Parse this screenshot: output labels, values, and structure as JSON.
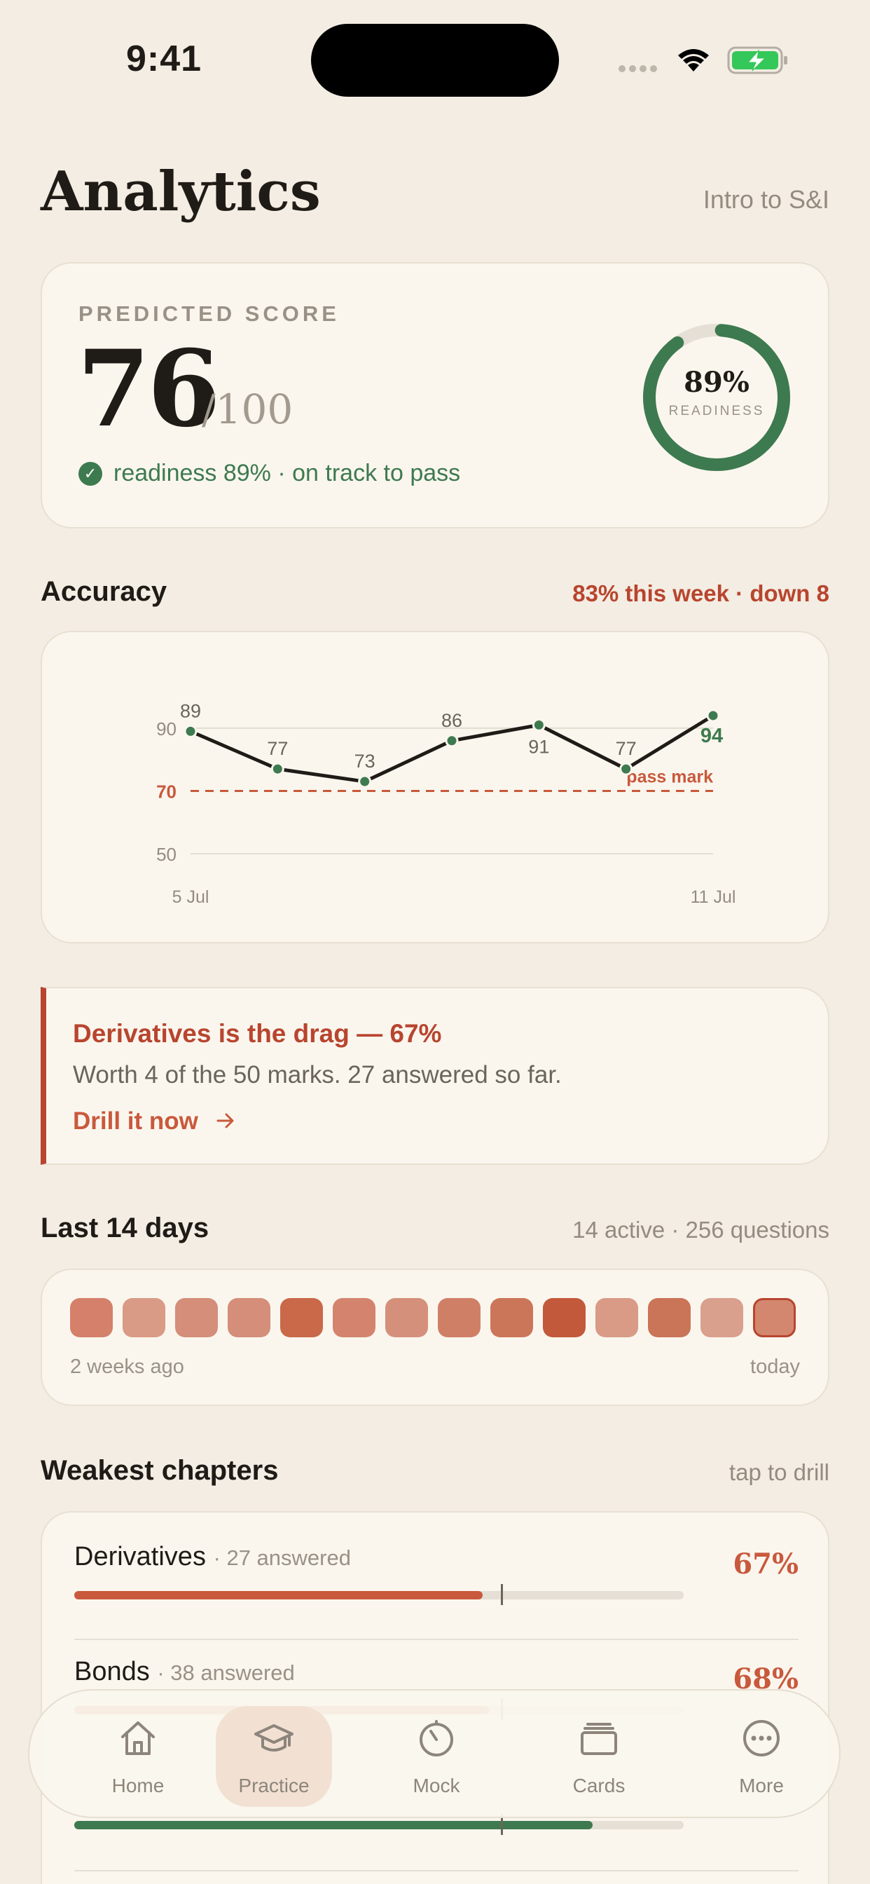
{
  "status": {
    "time": "9:41"
  },
  "header": {
    "title": "Analytics",
    "course": "Intro to S&I"
  },
  "predicted": {
    "label": "PREDICTED SCORE",
    "score": "76",
    "out_of": "/100",
    "status_text": "readiness 89% · on track to pass",
    "readiness_pct_text": "89%",
    "readiness_label": "READINESS",
    "readiness_value": 0.89
  },
  "accuracy": {
    "title": "Accuracy",
    "summary": "83% this week · down 8"
  },
  "chart_data": {
    "type": "line",
    "x": [
      "5 Jul",
      "6 Jul",
      "7 Jul",
      "8 Jul",
      "9 Jul",
      "10 Jul",
      "11 Jul"
    ],
    "values": [
      89,
      77,
      73,
      86,
      91,
      77,
      94
    ],
    "y_ticks": [
      "50",
      "70",
      "90"
    ],
    "x_tick_labels": [
      "5 Jul",
      "11 Jul"
    ],
    "threshold": {
      "value": 70,
      "label": "pass mark"
    },
    "ylim": [
      46,
      96
    ],
    "colors": {
      "line": "#1F1B16",
      "point": "#3E7A4F",
      "threshold": "#C9593C"
    }
  },
  "alert": {
    "title": "Derivatives is the drag — 67%",
    "body": "Worth 4 of the 50 marks. 27 answered so far.",
    "link": "Drill it now",
    "link_icon": "arrow-right-icon"
  },
  "activity": {
    "title": "Last 14 days",
    "summary": "14 active · 256 questions",
    "start_label": "2 weeks ago",
    "end_label": "today",
    "days": [
      "#D4806A",
      "#D99A86",
      "#D48E79",
      "#D48E79",
      "#C9694A",
      "#D4846E",
      "#D4907B",
      "#D07F67",
      "#CB7659",
      "#C2593A",
      "#D99A86",
      "#CA7458",
      "#D9A08D",
      "#D4876F"
    ]
  },
  "chapters": {
    "title": "Weakest chapters",
    "hint": "tap to drill",
    "items": [
      {
        "name": "Derivatives",
        "sub": "· 27 answered",
        "pct": "67%",
        "value": 0.67,
        "color": "#C9593C"
      },
      {
        "name": "Bonds",
        "sub": "· 38 answered",
        "pct": "68%",
        "value": 0.68,
        "color": "#C9593C"
      },
      {
        "name": "",
        "sub": "",
        "pct": "",
        "value": 0.85,
        "color": "#3E7A4F"
      }
    ],
    "pass_mark_fraction": 0.7
  },
  "tabbar": {
    "items": [
      {
        "label": "Home",
        "icon": "home-icon"
      },
      {
        "label": "Practice",
        "icon": "graduation-cap-icon"
      },
      {
        "label": "Mock",
        "icon": "timer-icon"
      },
      {
        "label": "Cards",
        "icon": "cards-icon"
      },
      {
        "label": "More",
        "icon": "more-icon"
      }
    ]
  }
}
